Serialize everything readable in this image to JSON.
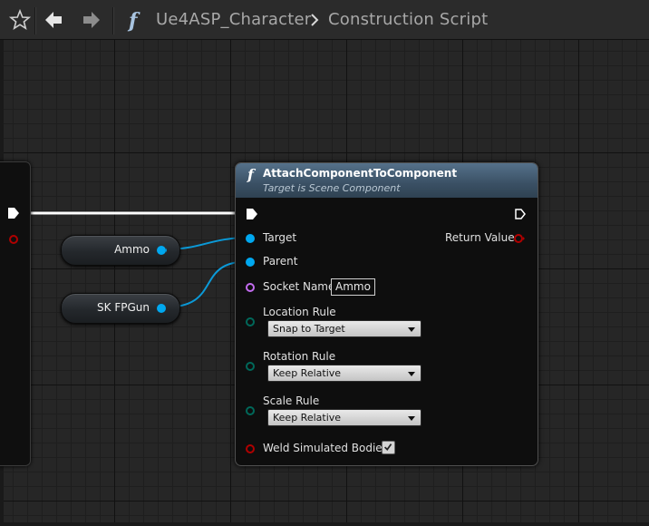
{
  "toolbar": {
    "breadcrumb": [
      "Ue4ASP_Character",
      "Construction Script"
    ]
  },
  "colors": {
    "object_pin": "#00a8f0",
    "name_pin": "#c36cf0",
    "enum_pin": "#00685a",
    "bool_pin": "#930000",
    "exec_pin": "#ffffff",
    "function_header": "#4c667d"
  },
  "variables": [
    {
      "label": "Ammo",
      "pin_color": "object"
    },
    {
      "label": "SK FPGun",
      "pin_color": "object"
    }
  ],
  "function_node": {
    "title": "AttachComponentToComponent",
    "subtitle": "Target is Scene Component",
    "inputs": {
      "target": "Target",
      "parent": "Parent",
      "socket_name_label": "Socket Name",
      "socket_name_value": "Ammo",
      "location_rule_label": "Location Rule",
      "location_rule_value": "Snap to Target",
      "rotation_rule_label": "Rotation Rule",
      "rotation_rule_value": "Keep Relative",
      "scale_rule_label": "Scale Rule",
      "scale_rule_value": "Keep Relative",
      "weld_label": "Weld Simulated Bodies",
      "weld_checked": true
    },
    "outputs": {
      "return_value": "Return Value"
    }
  }
}
